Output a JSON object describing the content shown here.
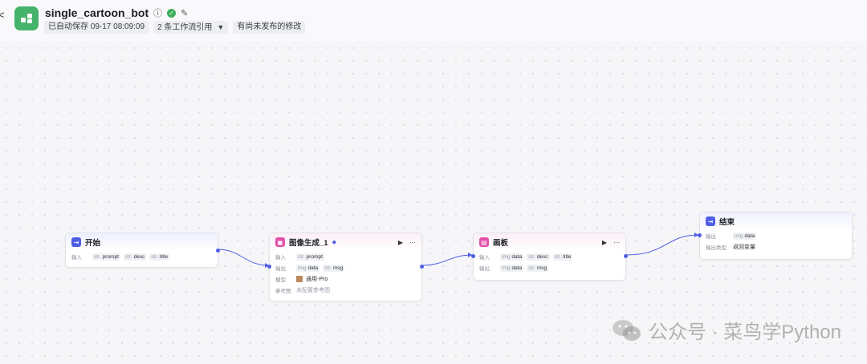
{
  "header": {
    "back_glyph": "<",
    "title": "single_cartoon_bot",
    "autosave": "已自动保存 09-17 08:09:09",
    "workflow_refs": "2 条工作流引用",
    "unpublished": "有尚未发布的修改"
  },
  "nodes": {
    "start": {
      "title": "开始",
      "input_label": "输入",
      "inputs": [
        {
          "type": "str.",
          "name": "prompt"
        },
        {
          "type": "str.",
          "name": "desc"
        },
        {
          "type": "str.",
          "name": "title"
        }
      ]
    },
    "image_gen": {
      "title": "图像生成_1",
      "input_label": "输入",
      "input": {
        "type": "str.",
        "name": "prompt"
      },
      "output_label": "输出",
      "outputs": [
        {
          "type": "img",
          "name": "data"
        },
        {
          "type": "str.",
          "name": "msg"
        }
      ],
      "model_label": "模型",
      "model_value": "通用-Pro",
      "ref_label": "参考图",
      "ref_value": "未配置参考图"
    },
    "canvas": {
      "title": "画板",
      "input_label": "输入",
      "inputs": [
        {
          "type": "img",
          "name": "data"
        },
        {
          "type": "str.",
          "name": "desc"
        },
        {
          "type": "str.",
          "name": "title"
        }
      ],
      "output_label": "输出",
      "outputs": [
        {
          "type": "img",
          "name": "data"
        },
        {
          "type": "str.",
          "name": "msg"
        }
      ]
    },
    "end": {
      "title": "结束",
      "output_label": "输出",
      "output": {
        "type": "img",
        "name": "data"
      },
      "output_type_label": "输出类型",
      "output_type_value": "返回变量"
    }
  },
  "watermark": "公众号 · 菜鸟学Python",
  "colors": {
    "accent": "#4e5ee4",
    "start_icon": "#4e5ee4",
    "image_icon": "#e24ea8",
    "canvas_icon": "#e24ea8",
    "end_icon": "#4e5ee4",
    "app_icon": "#45b36b"
  }
}
